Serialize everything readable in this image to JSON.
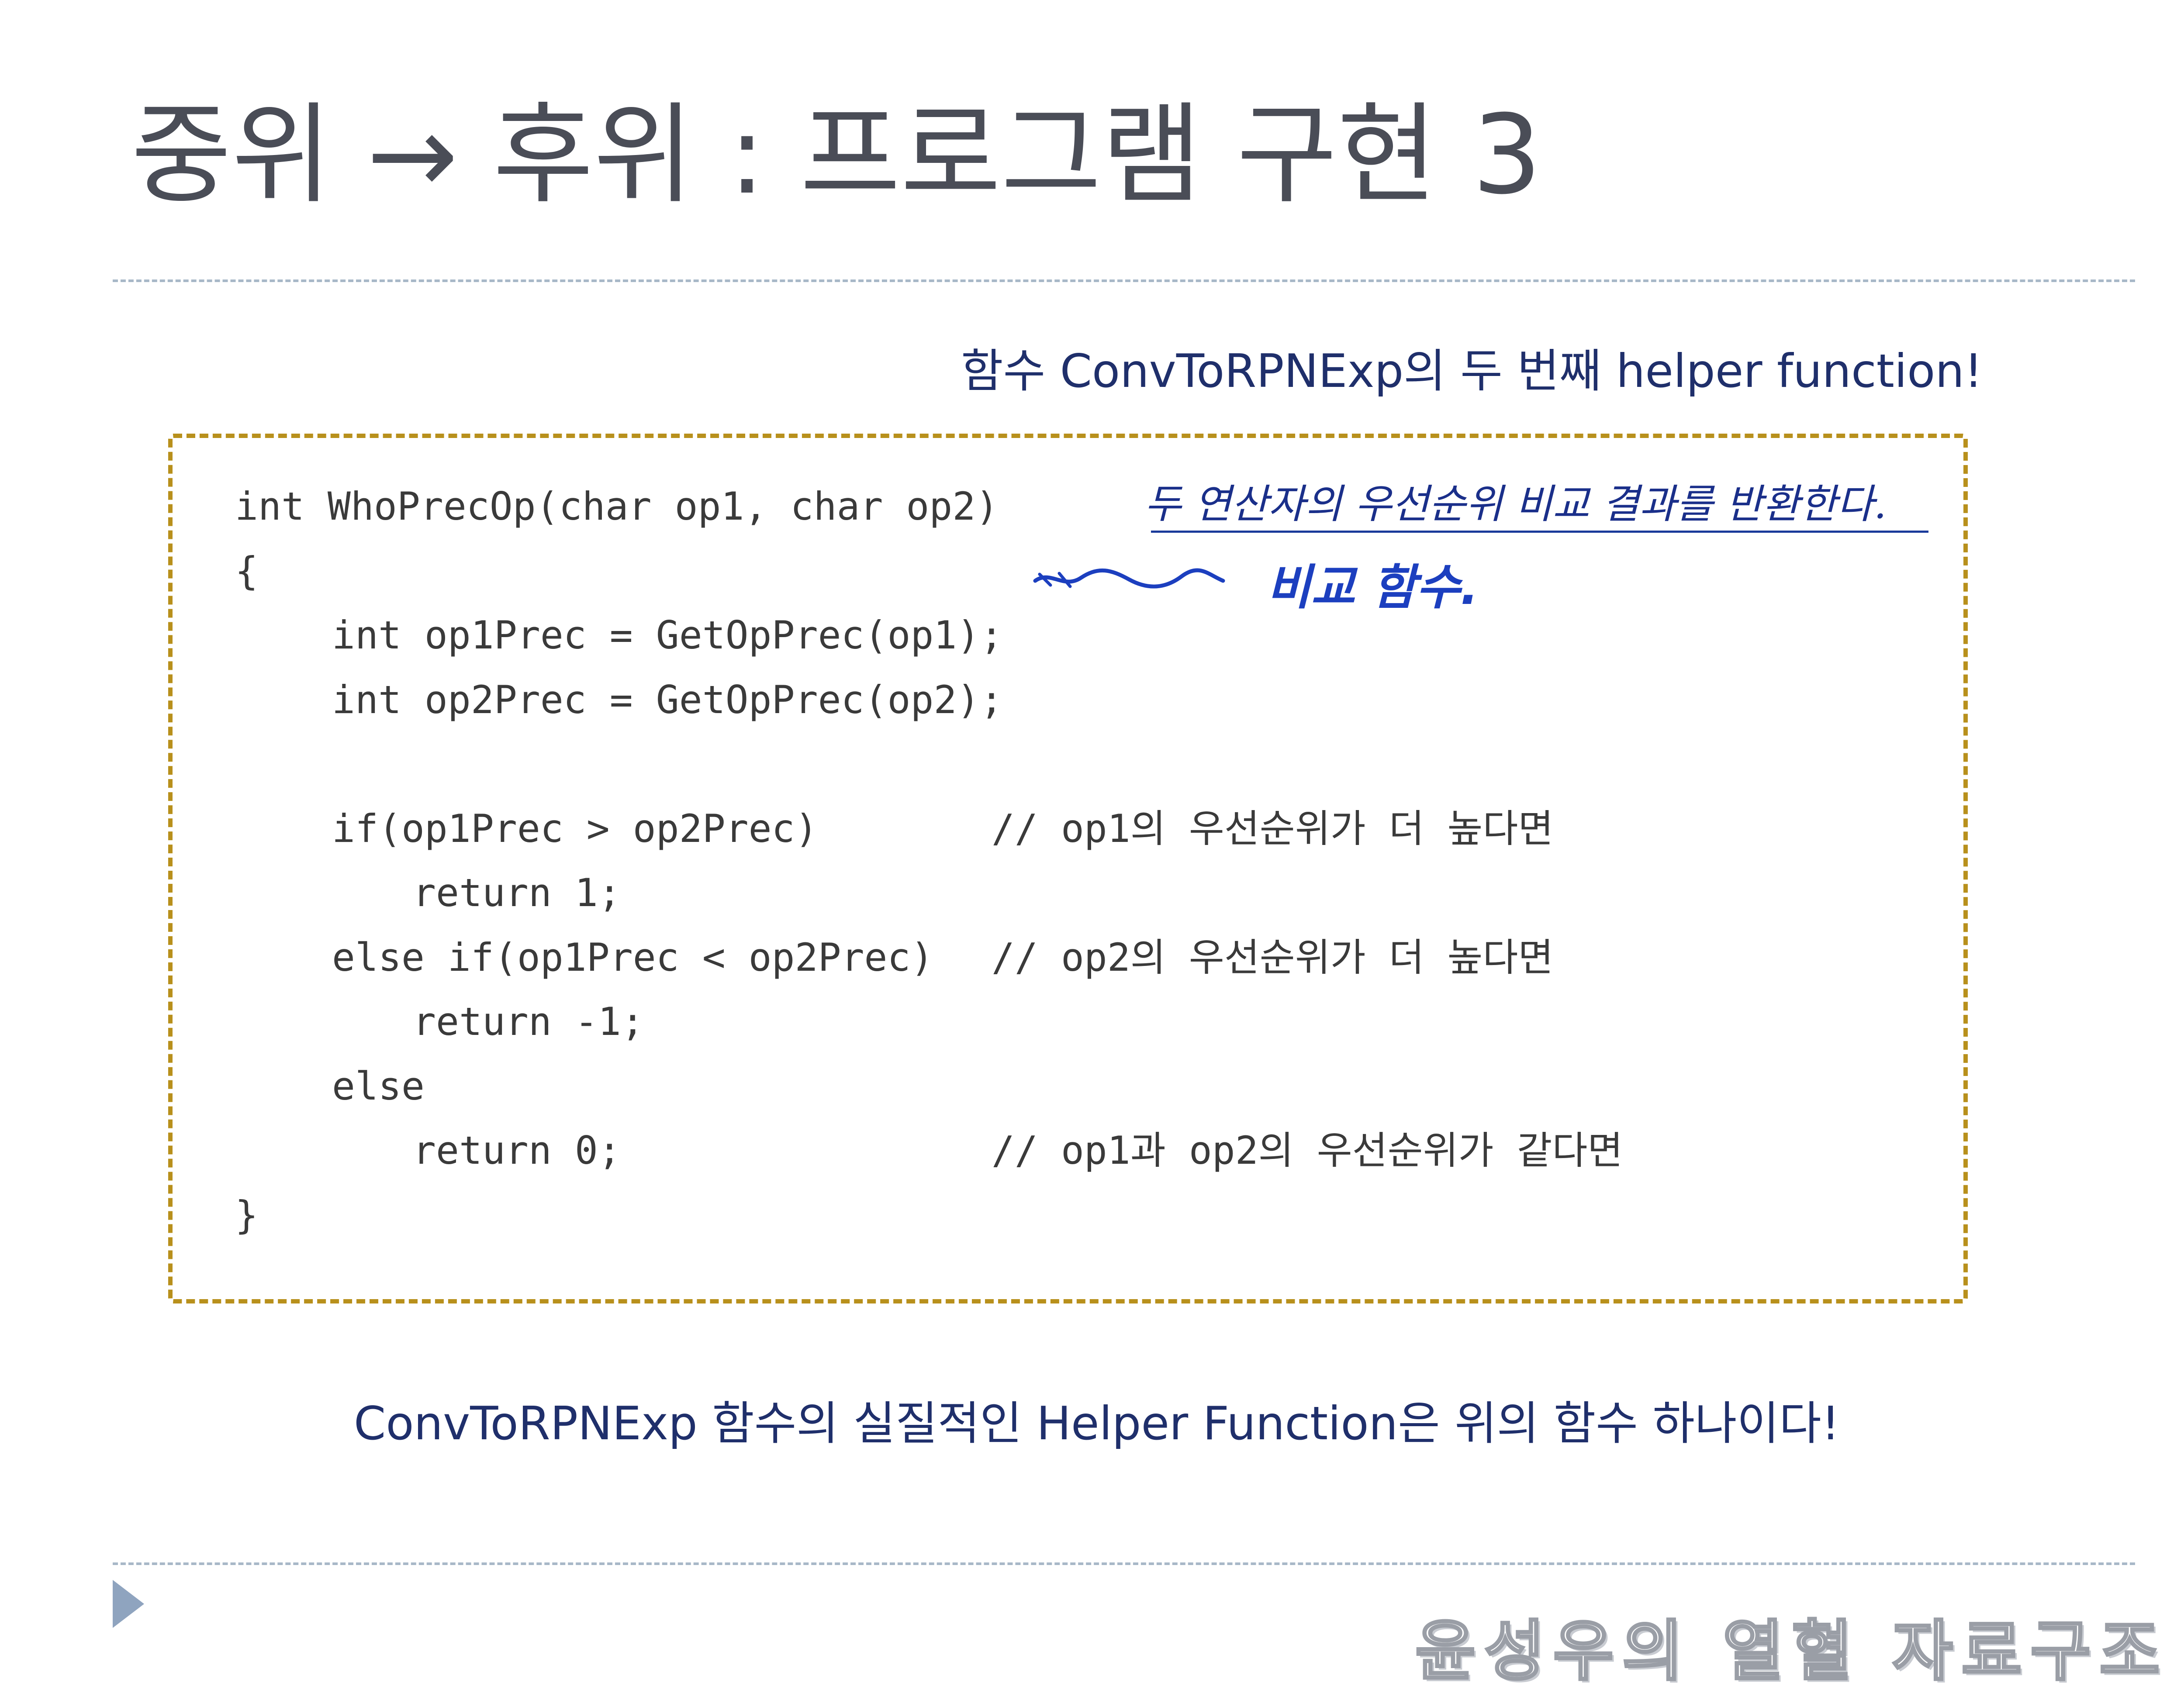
{
  "slide": {
    "title": "중위 → 후위 : 프로그램 구현 3",
    "subtitle": "함수 ConvToRPNExp의 두 번째 helper function!",
    "footer_note": "ConvToRPNExp 함수의 실질적인 Helper Function은 위의 함수 하나이다!",
    "brand": "윤성우의 열혈 자료구조"
  },
  "code": {
    "lines": [
      "int WhoPrecOp(char op1, char op2)",
      "{",
      "int op1Prec = GetOpPrec(op1);",
      "int op2Prec = GetOpPrec(op2);",
      "if(op1Prec > op2Prec)",
      "return 1;",
      "else if(op1Prec < op2Prec)",
      "return -1;",
      "else",
      "return 0;",
      "}"
    ],
    "comments": [
      "// op1의 우선순위가 더 높다면",
      "// op2의 우선순위가 더 높다면",
      "// op1과 op2의 우선순위가 같다면"
    ]
  },
  "annotations": {
    "handwritten_note": "두 연산자의 우선순위 비교 결과를 반환한다.",
    "handwritten_note_2": "비교 함수."
  },
  "colors": {
    "title": "#4a4d57",
    "text_blue": "#1f2f6b",
    "box_border": "#b8901c",
    "rule": "#a8b8c8",
    "ink": "#1c3fbf",
    "bullet": "#8fa4bf"
  },
  "icons": {
    "bullet": "triangle-right-icon"
  }
}
